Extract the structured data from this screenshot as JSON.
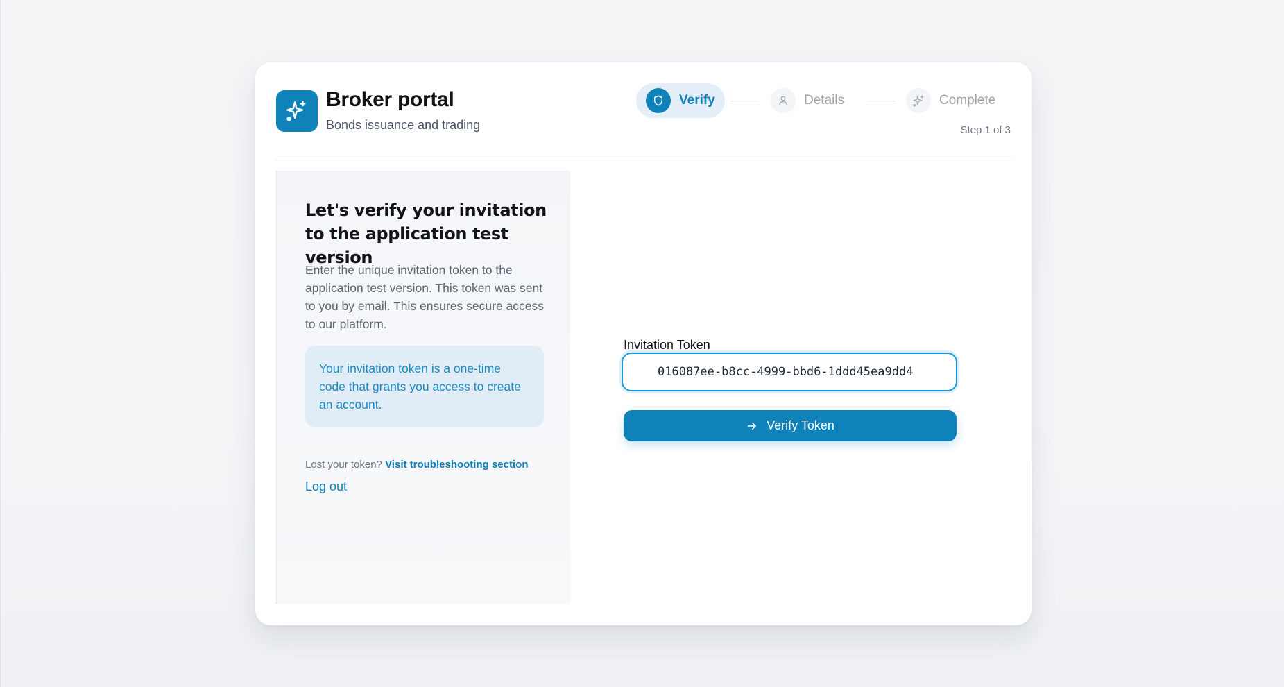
{
  "app": {
    "title": "Broker portal",
    "subtitle": "Bonds issuance and trading",
    "logo_icon": "sparkles-icon",
    "brand_color": "#0e82b9"
  },
  "stepper": {
    "steps": [
      {
        "label": "Verify",
        "icon": "shield-icon",
        "state": "active"
      },
      {
        "label": "Details",
        "icon": "user-icon",
        "state": "pending"
      },
      {
        "label": "Complete",
        "icon": "sparkles-icon",
        "state": "pending"
      }
    ],
    "counter": "Step 1 of 3"
  },
  "info": {
    "heading": "Let's verify your invitation to the application test version",
    "description": "Enter the unique invitation token to the application test version. This token was sent to you by email. This ensures secure access to our platform.",
    "note": "Your invitation token is a one-time code that grants you access to create an account.",
    "lost_prefix": "Lost your token?",
    "lost_link": "Visit troubleshooting section",
    "logout": "Log out"
  },
  "form": {
    "token_label": "Invitation Token",
    "token_value": "016087ee-b8cc-4999-bbd6-1ddd45ea9dd4",
    "submit_label": "Verify Token",
    "submit_icon": "arrow-right-icon"
  }
}
